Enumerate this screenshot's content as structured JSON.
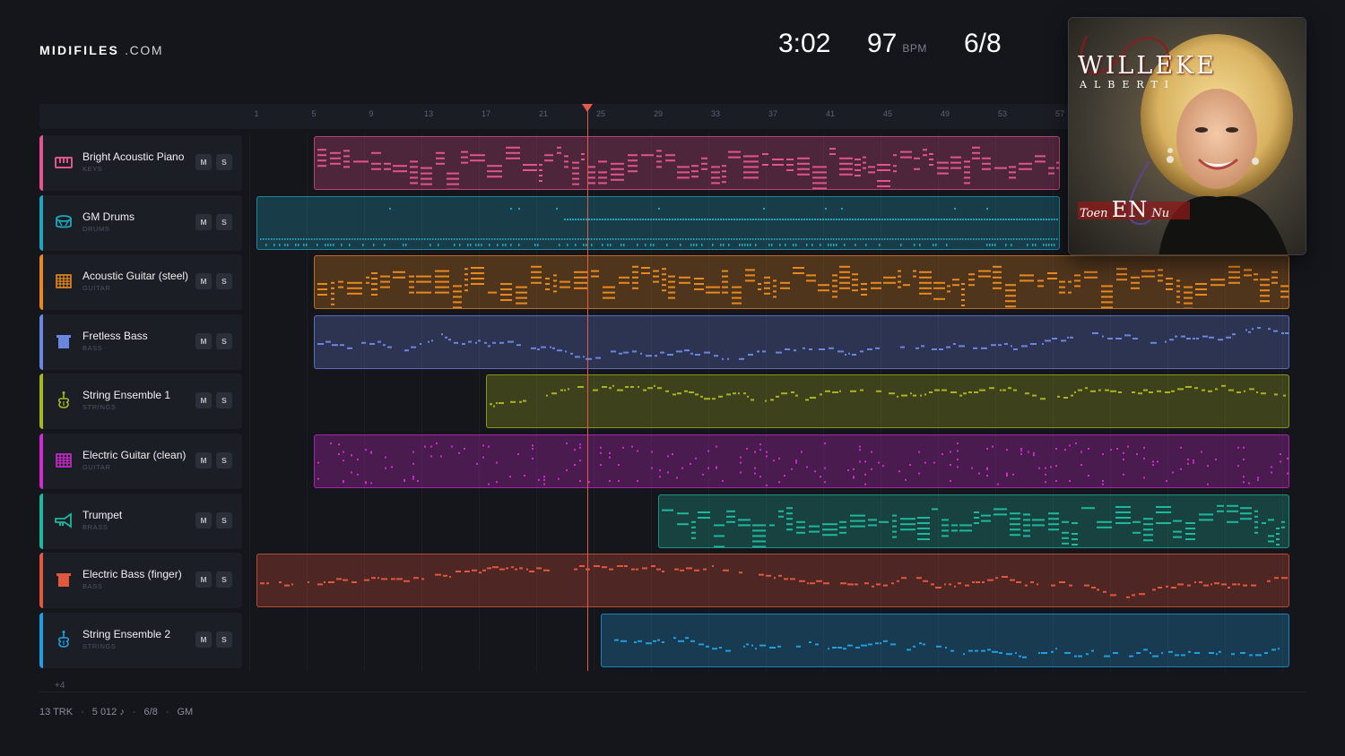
{
  "brand": {
    "name": "MIDIFILES",
    "domain": ".COM"
  },
  "stats": {
    "time": "3:02",
    "tempo": "97",
    "tempo_unit": "BPM",
    "meter": "6/8"
  },
  "ruler": {
    "ticks": [
      "1",
      "5",
      "9",
      "13",
      "17",
      "21",
      "25",
      "29",
      "33",
      "37",
      "41",
      "45",
      "49",
      "53",
      "57"
    ]
  },
  "playhead": {
    "bar": 25
  },
  "tracks": [
    {
      "name": "Bright Acoustic Piano",
      "category": "KEYS",
      "color": "#e2548c",
      "icon": "piano-keys-icon",
      "mute": "M",
      "solo": "S",
      "clip_start_bar": 5,
      "clip_end_bar": 57,
      "density": 0.9,
      "style": "chords"
    },
    {
      "name": "GM Drums",
      "category": "DRUMS",
      "color": "#1fa6bd",
      "icon": "drum-icon",
      "mute": "M",
      "solo": "S",
      "clip_start_bar": 1,
      "clip_end_bar": 57,
      "density": 0.5,
      "style": "drums"
    },
    {
      "name": "Acoustic Guitar (steel)",
      "category": "GUITAR",
      "color": "#e8891f",
      "icon": "guitar-fret-icon",
      "mute": "M",
      "solo": "S",
      "clip_start_bar": 5,
      "clip_end_bar": 73,
      "density": 0.95,
      "style": "chords"
    },
    {
      "name": "Fretless Bass",
      "category": "BASS",
      "color": "#6b86e0",
      "icon": "bass-icon",
      "mute": "M",
      "solo": "S",
      "clip_start_bar": 5,
      "clip_end_bar": 73,
      "density": 0.5,
      "style": "melody"
    },
    {
      "name": "String Ensemble 1",
      "category": "STRINGS",
      "color": "#a4b81e",
      "icon": "violin-icon",
      "mute": "M",
      "solo": "S",
      "clip_start_bar": 17,
      "clip_end_bar": 73,
      "density": 0.45,
      "style": "melody"
    },
    {
      "name": "Electric Guitar (clean)",
      "category": "GUITAR",
      "color": "#d12ad1",
      "icon": "guitar-fret-icon",
      "mute": "M",
      "solo": "S",
      "clip_start_bar": 5,
      "clip_end_bar": 73,
      "density": 0.35,
      "style": "dots"
    },
    {
      "name": "Trumpet",
      "category": "BRASS",
      "color": "#1db89d",
      "icon": "trumpet-icon",
      "mute": "M",
      "solo": "S",
      "clip_start_bar": 29,
      "clip_end_bar": 73,
      "density": 0.85,
      "style": "chords"
    },
    {
      "name": "Electric Bass (finger)",
      "category": "BASS",
      "color": "#e2573e",
      "icon": "bass-icon",
      "mute": "M",
      "solo": "S",
      "clip_start_bar": 1,
      "clip_end_bar": 73,
      "density": 0.45,
      "style": "melody"
    },
    {
      "name": "String Ensemble 2",
      "category": "STRINGS",
      "color": "#1f9fe0",
      "icon": "violin-icon",
      "mute": "M",
      "solo": "S",
      "clip_start_bar": 25,
      "clip_end_bar": 73,
      "density": 0.45,
      "style": "melody"
    }
  ],
  "more_tracks": "+4",
  "footer": {
    "tracks": "13 TRK",
    "notes": "5 012 ♪",
    "meter": "6/8",
    "standard": "GM"
  },
  "cover": {
    "artist": "WILLEKE",
    "artist_sub": "ALBERTI",
    "album_a": "Toen",
    "album_b": "EN",
    "album_c": "Nu"
  }
}
